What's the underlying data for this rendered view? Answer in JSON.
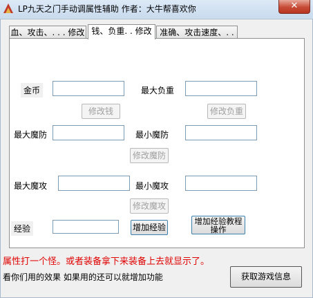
{
  "window": {
    "title": "LP九天之门手动调属性辅助  作者：大牛帮喜欢你",
    "close_label": "✕"
  },
  "tabs": [
    {
      "label": "血、攻击、. . . 修改"
    },
    {
      "label": "钱、负重. . 修改"
    },
    {
      "label": "准确、攻击速度、. ."
    }
  ],
  "fields": {
    "gold_label": "金币",
    "max_weight_label": "最大负重",
    "max_mdef_label": "最大魔防",
    "min_mdef_label": "最小魔防",
    "max_matk_label": "最大魔攻",
    "min_matk_label": "最小魔攻",
    "exp_label": "经验"
  },
  "buttons": {
    "modify_money": "修改钱",
    "modify_weight": "修改负重",
    "modify_mdef": "修改魔防",
    "modify_matk": "修改魔攻",
    "add_exp": "增加经验",
    "exp_tutorial": "增加经验教程操作",
    "get_game_info": "获取游戏信息"
  },
  "messages": {
    "red_hint": "属性打一个怪。或者装备拿下来装备上去就显示了。",
    "note": "看你们用的效果 如果用的还可以就增加功能"
  },
  "colors": {
    "warning": "#e00000"
  }
}
